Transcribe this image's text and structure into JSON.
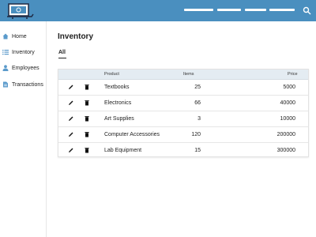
{
  "header": {
    "logo_icon": "laptop-cart-icon",
    "search_icon": "search-icon",
    "accent": "#4a8fbf"
  },
  "sidebar": {
    "items": [
      {
        "label": "Home",
        "icon": "home-icon"
      },
      {
        "label": "Inventory",
        "icon": "list-icon"
      },
      {
        "label": "Employees",
        "icon": "person-icon"
      },
      {
        "label": "Transactions",
        "icon": "document-icon"
      }
    ]
  },
  "main": {
    "title": "Inventory",
    "tabs": [
      {
        "label": "All"
      }
    ]
  },
  "table": {
    "columns": [
      "Product",
      "Items",
      "Price"
    ],
    "rows": [
      {
        "product": "Textbooks",
        "items": "25",
        "price": "5000"
      },
      {
        "product": "Electronics",
        "items": "66",
        "price": "40000"
      },
      {
        "product": "Art Supplies",
        "items": "3",
        "price": "10000"
      },
      {
        "product": "Computer Accessories",
        "items": "120",
        "price": "200000"
      },
      {
        "product": "Lab Equipment",
        "items": "15",
        "price": "300000"
      }
    ],
    "row_actions": [
      "edit-icon",
      "delete-icon"
    ]
  }
}
